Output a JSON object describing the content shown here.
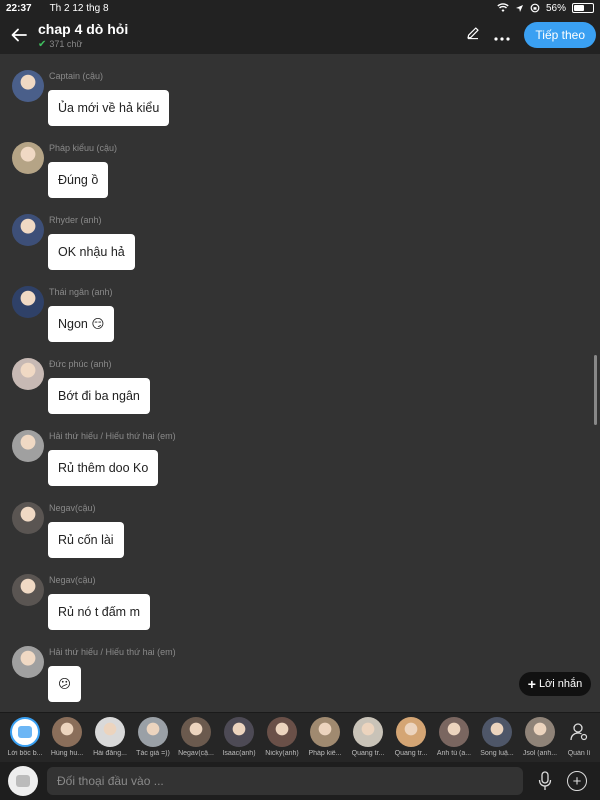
{
  "status_bar": {
    "time": "22:37",
    "date": "Th 2 12 thg 8",
    "battery": "56%",
    "battery_level": 0.56
  },
  "header": {
    "back_icon": "arrow-left-icon",
    "title": "chap 4 dò hỏi",
    "word_count": "371 chữ",
    "edit_icon": "pencil-icon",
    "more_icon": "more-horizontal-icon",
    "next_label": "Tiếp theo"
  },
  "messages": [
    {
      "sender": "Captain (cậu)",
      "text": "Ủa mới về hả kiểu",
      "avatar_color": "#4a5f8a"
    },
    {
      "sender": "Pháp kiểuu (cậu)",
      "text": "Đúng ồ",
      "avatar_color": "#b5a486"
    },
    {
      "sender": "Rhyder (anh)",
      "text": "OK nhậu hả",
      "avatar_color": "#3d4f78"
    },
    {
      "sender": "Thái ngân (anh)",
      "text": "Ngon 😏",
      "avatar_color": "#2f4168"
    },
    {
      "sender": "Đức phúc (anh)",
      "text": "Bớt đi ba ngân",
      "avatar_color": "#c7b9b4"
    },
    {
      "sender": "Hải thứ hiếu / Hiếu thứ hai (em)",
      "text": "Rủ thêm doo Ko",
      "avatar_color": "#a0a0a0"
    },
    {
      "sender": "Negav(cậu)",
      "text": "Rủ cốn lài",
      "avatar_color": "#5a5552"
    },
    {
      "sender": "Negav(cậu)",
      "text": "Rủ nó t đấm m",
      "avatar_color": "#5a5552"
    },
    {
      "sender": "Hải thứ hiếu / Hiếu thứ hai (em)",
      "text": "😕",
      "avatar_color": "#a0a0a0"
    }
  ],
  "note_button": {
    "label": "Lời nhắn",
    "icon": "plus-icon"
  },
  "characters": [
    {
      "name": "Lời bốc b...",
      "color": "#ffffff",
      "narrator": true
    },
    {
      "name": "Hùng hu...",
      "color": "#8a6e5a"
    },
    {
      "name": "Hải đăng...",
      "color": "#d9d9d9"
    },
    {
      "name": "Tác giả =))",
      "color": "#9aa0a6"
    },
    {
      "name": "Negav(cậ...",
      "color": "#6b5a4e"
    },
    {
      "name": "Isaac(anh)",
      "color": "#4d4a55"
    },
    {
      "name": "Nicky(anh)",
      "color": "#6a5048"
    },
    {
      "name": "Pháp kiể...",
      "color": "#a08a70"
    },
    {
      "name": "Quang tr...",
      "color": "#c9c3b8"
    },
    {
      "name": "Quang tr...",
      "color": "#d4a574"
    },
    {
      "name": "Anh tú (a...",
      "color": "#7a6660"
    },
    {
      "name": "Song luậ...",
      "color": "#4e5668"
    },
    {
      "name": "Jsol (anh...",
      "color": "#8f8378"
    }
  ],
  "manage": {
    "label": "Quản lí",
    "icon": "user-settings-icon"
  },
  "input": {
    "chat_icon": "chat-bubble-icon",
    "placeholder": "Đối thoại đầu vào ...",
    "mic_icon": "microphone-icon",
    "add_icon": "plus-circle-icon"
  },
  "colors": {
    "background": "#333333",
    "bars": "#222222",
    "accent": "#3aa0f2",
    "bubble": "#ffffff"
  }
}
